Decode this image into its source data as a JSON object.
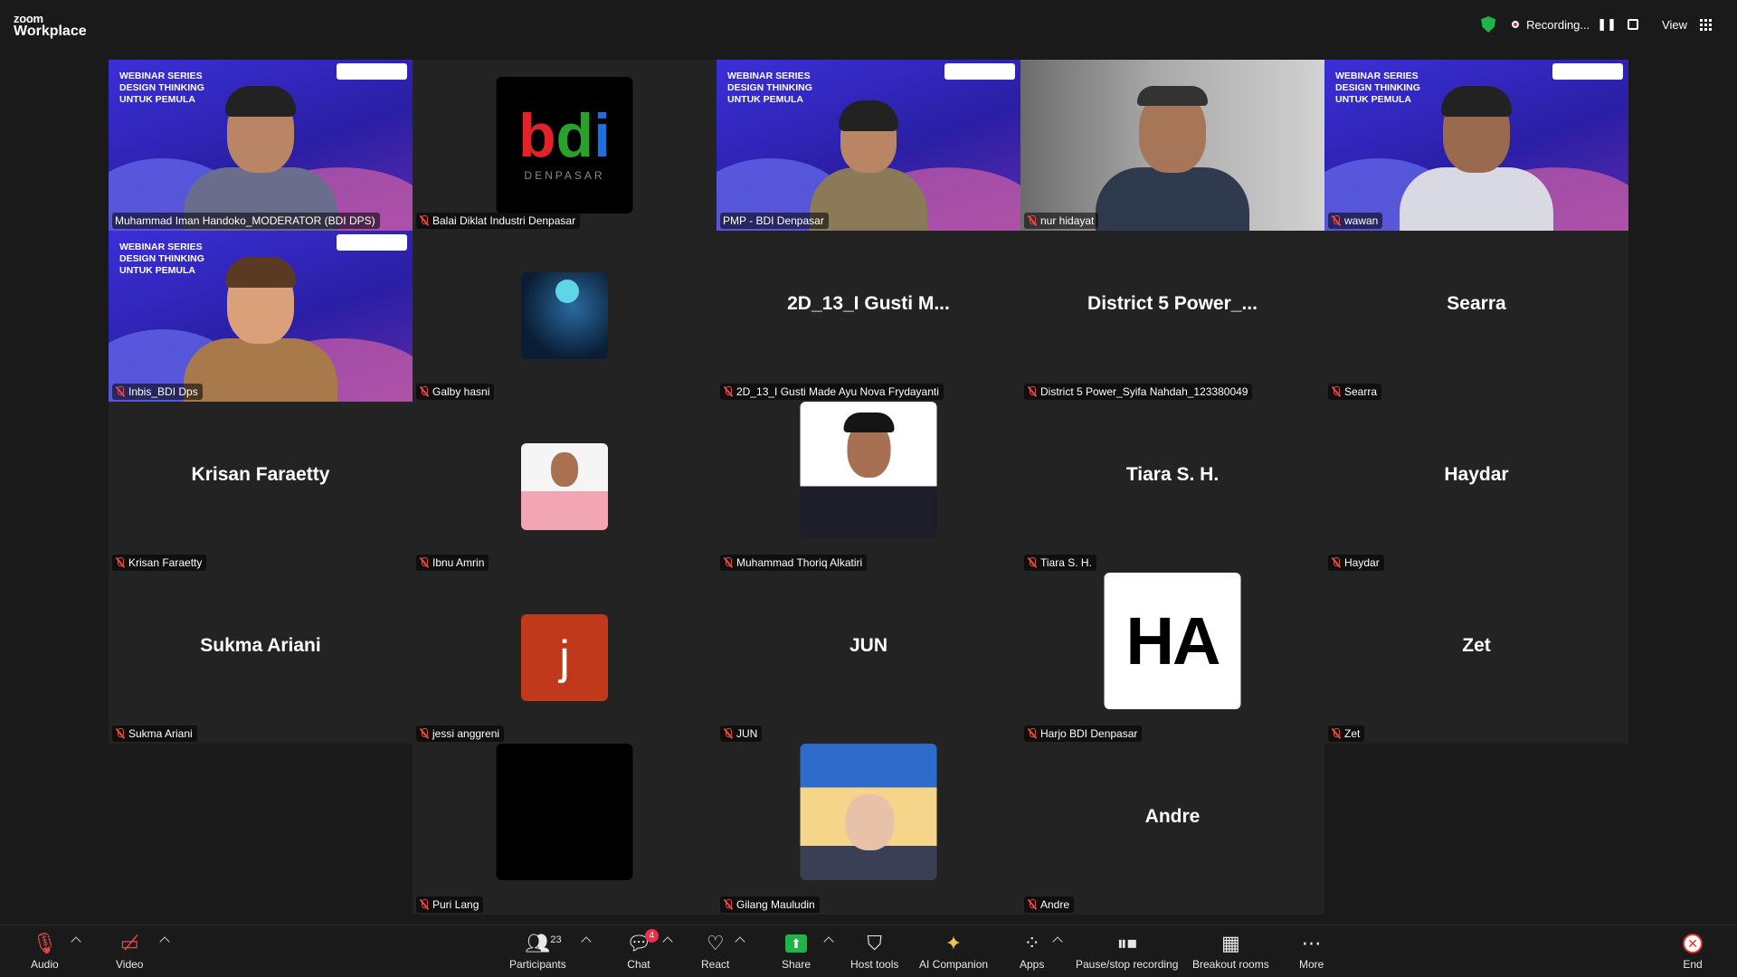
{
  "app": {
    "logo_top": "zoom",
    "logo_bottom": "Workplace"
  },
  "topbar": {
    "recording_label": "Recording...",
    "view_label": "View"
  },
  "webinar_overlay": {
    "series": "WEBINAR SERIES",
    "line1": "DESIGN THINKING",
    "line2": "UNTUK PEMULA"
  },
  "tiles": [
    {
      "label": "Muhammad Iman Handoko_MODERATOR (BDI DPS)",
      "active": true,
      "kind": "video-webinar"
    },
    {
      "label": "Balai Diklat Industri Denpasar",
      "kind": "logo-bdi",
      "logo_text_b": "b",
      "logo_text_d": "d",
      "logo_text_i": "i",
      "logo_sub": "DENPASAR"
    },
    {
      "label": "PMP - BDI Denpasar",
      "kind": "video-webinar"
    },
    {
      "label": "nur hidayat",
      "kind": "video-car"
    },
    {
      "label": "wawan",
      "kind": "video-webinar"
    },
    {
      "label": "Inbis_BDI Dps",
      "kind": "video-webinar-avatar"
    },
    {
      "label": "Galby hasni",
      "kind": "image-anime"
    },
    {
      "label": "2D_13_I Gusti Made Ayu Nova Frydayanti",
      "center": "2D_13_I Gusti M...",
      "kind": "name"
    },
    {
      "label": "District 5 Power_Syifa Nahdah_123380049",
      "center": "District 5 Power_...",
      "kind": "name"
    },
    {
      "label": "Searra",
      "center": "Searra",
      "kind": "name"
    },
    {
      "label": "Krisan Faraetty",
      "center": "Krisan Faraetty",
      "kind": "name"
    },
    {
      "label": "Ibnu Amrin",
      "kind": "photo-small"
    },
    {
      "label": "Muhammad Thoriq Alkatiri",
      "kind": "photo-large"
    },
    {
      "label": "Tiara S. H.",
      "center": "Tiara S. H.",
      "kind": "name"
    },
    {
      "label": "Haydar",
      "center": "Haydar",
      "kind": "name"
    },
    {
      "label": "Sukma Ariani",
      "center": "Sukma Ariani",
      "kind": "name"
    },
    {
      "label": "jessi anggreni",
      "letter": "j",
      "kind": "letter-small"
    },
    {
      "label": "JUN",
      "center": "JUN",
      "kind": "name"
    },
    {
      "label": "Harjo BDI Denpasar",
      "letter": "HA",
      "kind": "letter-large"
    },
    {
      "label": "Zet",
      "center": "Zet",
      "kind": "name"
    },
    {
      "label": "Puri Lang",
      "kind": "black"
    },
    {
      "label": "Gilang Mauludin",
      "kind": "cosplay"
    },
    {
      "label": "Andre",
      "center": "Andre",
      "kind": "name"
    }
  ],
  "toolbar": {
    "audio": "Audio",
    "video": "Video",
    "participants": "Participants",
    "participants_count": "23",
    "chat": "Chat",
    "chat_badge": "4",
    "react": "React",
    "share": "Share",
    "host_tools": "Host tools",
    "ai_companion": "AI Companion",
    "apps": "Apps",
    "pause_stop": "Pause/stop recording",
    "breakout": "Breakout rooms",
    "more": "More",
    "end": "End"
  },
  "colors": {
    "active_border": "#2fcc71",
    "mic_muted": "#e34b4b",
    "share_green": "#1fb34a",
    "end_red": "#e02b2b"
  }
}
